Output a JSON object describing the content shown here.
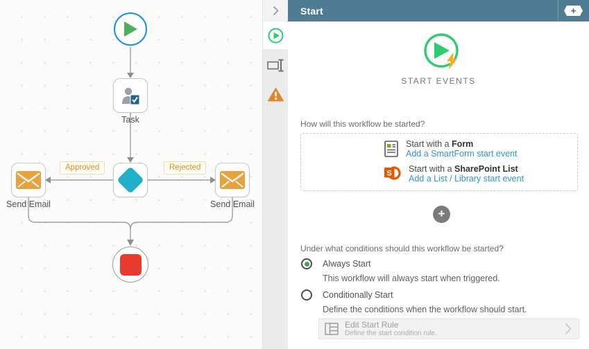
{
  "canvas": {
    "nodes": {
      "task": {
        "label": "Task"
      },
      "email_left": {
        "label": "Send Email"
      },
      "email_right": {
        "label": "Send Email"
      }
    },
    "branch_labels": {
      "approved": "Approved",
      "rejected": "Rejected"
    }
  },
  "panel": {
    "header": {
      "title": "Start",
      "add_label": "+"
    },
    "tabs": [
      {
        "name": "start-events",
        "icon": "play-circle-icon",
        "active": true
      },
      {
        "name": "rename",
        "icon": "rename-icon",
        "active": false
      },
      {
        "name": "warnings",
        "icon": "warning-icon",
        "active": false
      }
    ],
    "start_events": {
      "heading": "START EVENTS",
      "question_how": "How will this workflow be started?",
      "options": [
        {
          "title_prefix": "Start with a ",
          "title_bold": "Form",
          "link": "Add a SmartForm start event",
          "icon": "smartform-icon"
        },
        {
          "title_prefix": "Start with a ",
          "title_bold": "SharePoint List",
          "link": "Add a List / Library start event",
          "icon": "sharepoint-icon"
        }
      ],
      "add_event_label": "+",
      "question_conditions": "Under what conditions should this workflow be started?",
      "radios": [
        {
          "label": "Always Start",
          "description": "This workflow will always start when triggered.",
          "selected": true
        },
        {
          "label": "Conditionally Start",
          "description": "Define the conditions when the workflow should start.",
          "selected": false
        }
      ],
      "edit_rule": {
        "title": "Edit Start Rule",
        "subtitle": "Define the start condition rule."
      }
    }
  },
  "colors": {
    "header_bg": "#4e7d93",
    "accent_green": "#2ecc71",
    "canvas_play_green": "#4fae5f",
    "start_ring_blue": "#1b8de0",
    "decision_teal": "#1fb0c8",
    "email_orange": "#e9a23b",
    "stop_red": "#e8392f",
    "warning_orange": "#e0862e",
    "link_blue": "#2e95d3",
    "branch_label_orange": "#dd8e27",
    "lightning_yellow": "#f2b01e"
  }
}
